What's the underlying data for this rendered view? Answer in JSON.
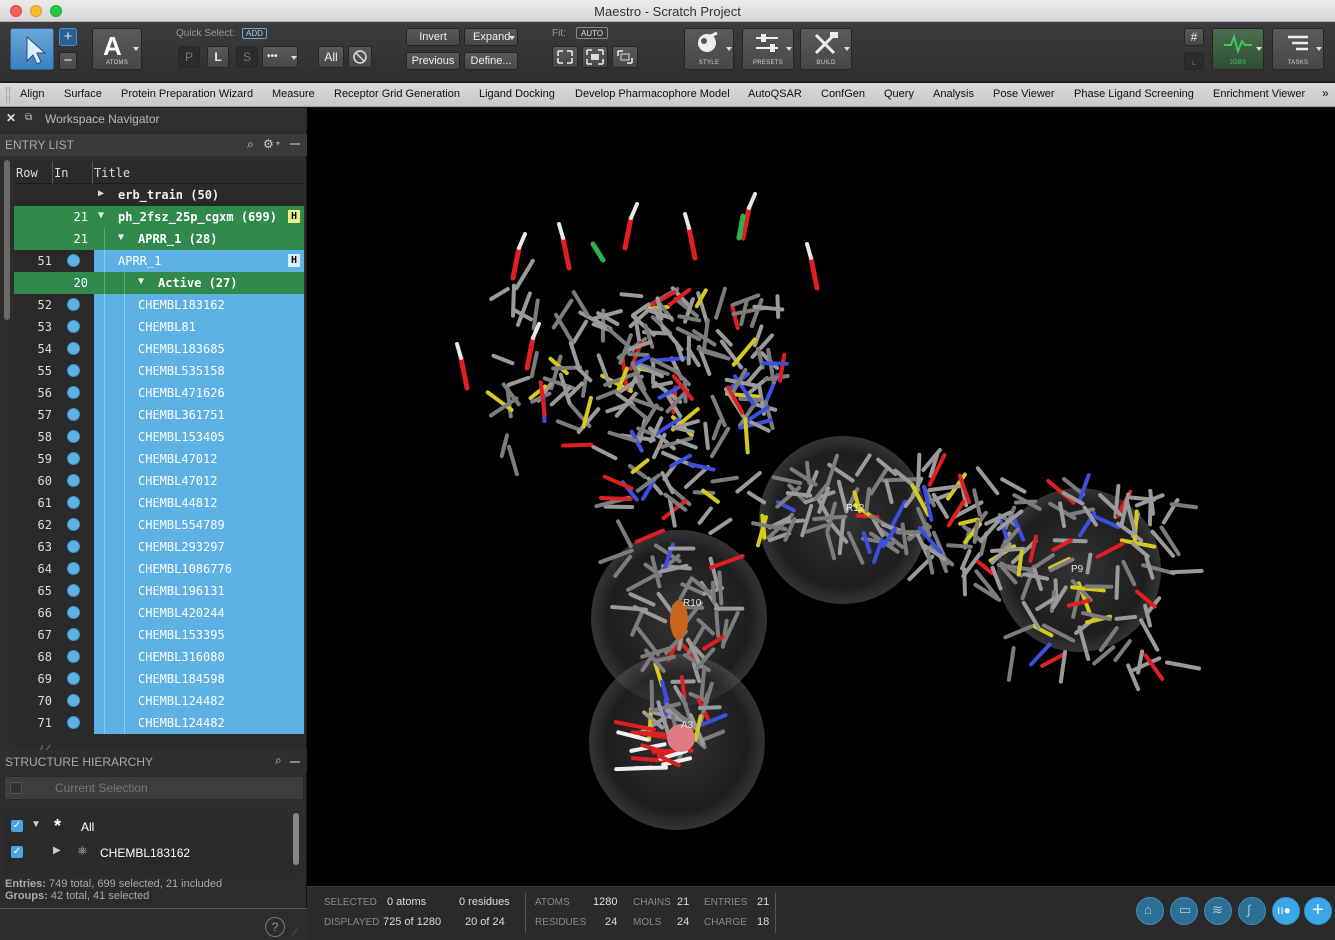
{
  "window": {
    "title": "Maestro - Scratch Project"
  },
  "toolbar": {
    "atoms_label": "ATOMS",
    "quick_select_label": "Quick Select:",
    "quick_select_badge": "ADD",
    "p": "P",
    "l": "L",
    "s": "S",
    "more": "•••",
    "all": "All",
    "invert": "Invert",
    "expand": "Expand",
    "previous": "Previous",
    "define": "Define...",
    "fit_label": "Fit:",
    "fit_badge": "AUTO",
    "style_label": "STYLE",
    "presets_label": "PRESETS",
    "build_label": "BUILD",
    "jobs_label": "JOBS",
    "tasks_label": "TASKS"
  },
  "menu": [
    "Align",
    "Surface",
    "Protein Preparation Wizard",
    "Measure",
    "Receptor Grid Generation",
    "Ligand Docking",
    "Develop Pharmacophore Model",
    "AutoQSAR",
    "ConfGen",
    "Query",
    "Analysis",
    "Pose Viewer",
    "Phase Ligand Screening",
    "Enrichment Viewer"
  ],
  "navigator": {
    "title": "Workspace Navigator"
  },
  "entry_list": {
    "header": "ENTRY LIST",
    "columns": [
      "Row",
      "In",
      "Title"
    ],
    "rows": [
      {
        "row": "",
        "in": "",
        "title": "erb_train (50)",
        "kind": "group-collapsed",
        "indent": 0
      },
      {
        "row": "",
        "in": "21",
        "title": "ph_2fsz_25p_cgxm (699)",
        "kind": "group-open",
        "indent": 0,
        "badge": "H"
      },
      {
        "row": "",
        "in": "21",
        "title": "APRR_1 (28)",
        "kind": "group-open",
        "indent": 1
      },
      {
        "row": "51",
        "in": "dot",
        "title": "APRR_1",
        "kind": "entry",
        "indent": 1,
        "badge": "H"
      },
      {
        "row": "",
        "in": "20",
        "title": "Active (27)",
        "kind": "group-open",
        "indent": 2
      },
      {
        "row": "52",
        "in": "dot",
        "title": "CHEMBL183162",
        "kind": "entry",
        "indent": 2
      },
      {
        "row": "53",
        "in": "dot",
        "title": "CHEMBL81",
        "kind": "entry",
        "indent": 2
      },
      {
        "row": "54",
        "in": "dot",
        "title": "CHEMBL183685",
        "kind": "entry",
        "indent": 2
      },
      {
        "row": "55",
        "in": "dot",
        "title": "CHEMBL535158",
        "kind": "entry",
        "indent": 2
      },
      {
        "row": "56",
        "in": "dot",
        "title": "CHEMBL471626",
        "kind": "entry",
        "indent": 2
      },
      {
        "row": "57",
        "in": "dot",
        "title": "CHEMBL361751",
        "kind": "entry",
        "indent": 2
      },
      {
        "row": "58",
        "in": "dot",
        "title": "CHEMBL153405",
        "kind": "entry",
        "indent": 2
      },
      {
        "row": "59",
        "in": "dot",
        "title": "CHEMBL47012",
        "kind": "entry",
        "indent": 2
      },
      {
        "row": "60",
        "in": "dot",
        "title": "CHEMBL47012",
        "kind": "entry",
        "indent": 2
      },
      {
        "row": "61",
        "in": "dot",
        "title": "CHEMBL44812",
        "kind": "entry",
        "indent": 2
      },
      {
        "row": "62",
        "in": "dot",
        "title": "CHEMBL554789",
        "kind": "entry",
        "indent": 2
      },
      {
        "row": "63",
        "in": "dot",
        "title": "CHEMBL293297",
        "kind": "entry",
        "indent": 2
      },
      {
        "row": "64",
        "in": "dot",
        "title": "CHEMBL1086776",
        "kind": "entry",
        "indent": 2
      },
      {
        "row": "65",
        "in": "dot",
        "title": "CHEMBL196131",
        "kind": "entry",
        "indent": 2
      },
      {
        "row": "66",
        "in": "dot",
        "title": "CHEMBL420244",
        "kind": "entry",
        "indent": 2
      },
      {
        "row": "67",
        "in": "dot",
        "title": "CHEMBL153395",
        "kind": "entry",
        "indent": 2
      },
      {
        "row": "68",
        "in": "dot",
        "title": "CHEMBL316080",
        "kind": "entry",
        "indent": 2
      },
      {
        "row": "69",
        "in": "dot",
        "title": "CHEMBL184598",
        "kind": "entry",
        "indent": 2
      },
      {
        "row": "70",
        "in": "dot",
        "title": "CHEMBL124482",
        "kind": "entry",
        "indent": 2
      },
      {
        "row": "71",
        "in": "dot",
        "title": "CHEMBL124482",
        "kind": "entry",
        "indent": 2
      }
    ]
  },
  "structure_hierarchy": {
    "header": "STRUCTURE HIERARCHY",
    "current_selection": "Current Selection",
    "items": [
      {
        "label": "All"
      },
      {
        "label": "CHEMBL183162"
      }
    ]
  },
  "summary": {
    "entries_label": "Entries:",
    "entries_text": "749 total, 699 selected, 21 included",
    "groups_label": "Groups:",
    "groups_text": "42 total, 41 selected"
  },
  "viewport_labels": {
    "r10": "R10",
    "r12": "R12",
    "p9": "P9",
    "a3": "A3"
  },
  "colors": {
    "selected_blue": "#5eb1e4",
    "group_green": "#2f8a4c",
    "jobs_green": "#41c85a",
    "oxygen": "#e02020",
    "sulfur": "#d6c91e",
    "nitrogen": "#3b4fe0",
    "carbon": "#8d8d8d"
  },
  "status": {
    "selected_label": "SELECTED",
    "selected_atoms": "0 atoms",
    "selected_residues": "0 residues",
    "displayed_label": "DISPLAYED",
    "displayed_atoms": "725 of 1280",
    "displayed_residues": "20 of 24",
    "atoms_label": "ATOMS",
    "atoms": "1280",
    "chains_label": "CHAINS",
    "chains": "21",
    "entries_label": "ENTRIES",
    "entries": "21",
    "residues_label": "RESIDUES",
    "residues": "24",
    "mols_label": "MOLS",
    "mols": "24",
    "charge_label": "CHARGE",
    "charge": "18"
  }
}
